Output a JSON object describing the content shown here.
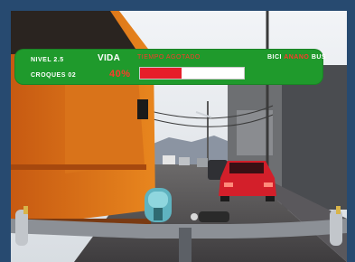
{
  "hud": {
    "nivel": "NIVEL 2.5",
    "croques": "CROQUES 02",
    "vida_label": "VIDA",
    "tiempo": "TIEMPO AGOTADO",
    "percent": "40%",
    "bici_prefix": "BICI",
    "bici_value": "ANANO",
    "bici_suffix": "BUS",
    "life_fraction": 0.4
  },
  "colors": {
    "hud_bg": "#1f9a2c",
    "life_fill": "#e61e2a",
    "warning_text": "#ff3a2a",
    "frame": "#274a70"
  }
}
